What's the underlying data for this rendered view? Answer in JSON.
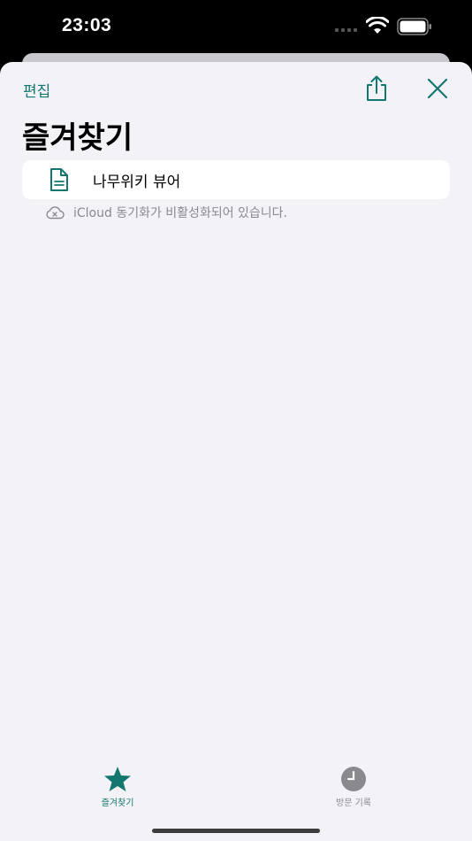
{
  "status": {
    "time": "23:03"
  },
  "header": {
    "edit_label": "편집",
    "title": "즐겨찾기"
  },
  "favorites": {
    "items": [
      {
        "label": "나무위키 뷰어",
        "icon": "document-icon"
      }
    ]
  },
  "sync_note": {
    "text": "iCloud 동기화가 비활성화되어 있습니다.",
    "icon": "cloud-off-icon"
  },
  "tabs": [
    {
      "label": "즐겨찾기",
      "icon": "star-icon",
      "selected": true
    },
    {
      "label": "방문 기록",
      "icon": "clock-icon",
      "selected": false
    }
  ],
  "colors": {
    "accent": "#13776f",
    "background": "#f2f2f7",
    "secondary_text": "#8a8a8e"
  }
}
